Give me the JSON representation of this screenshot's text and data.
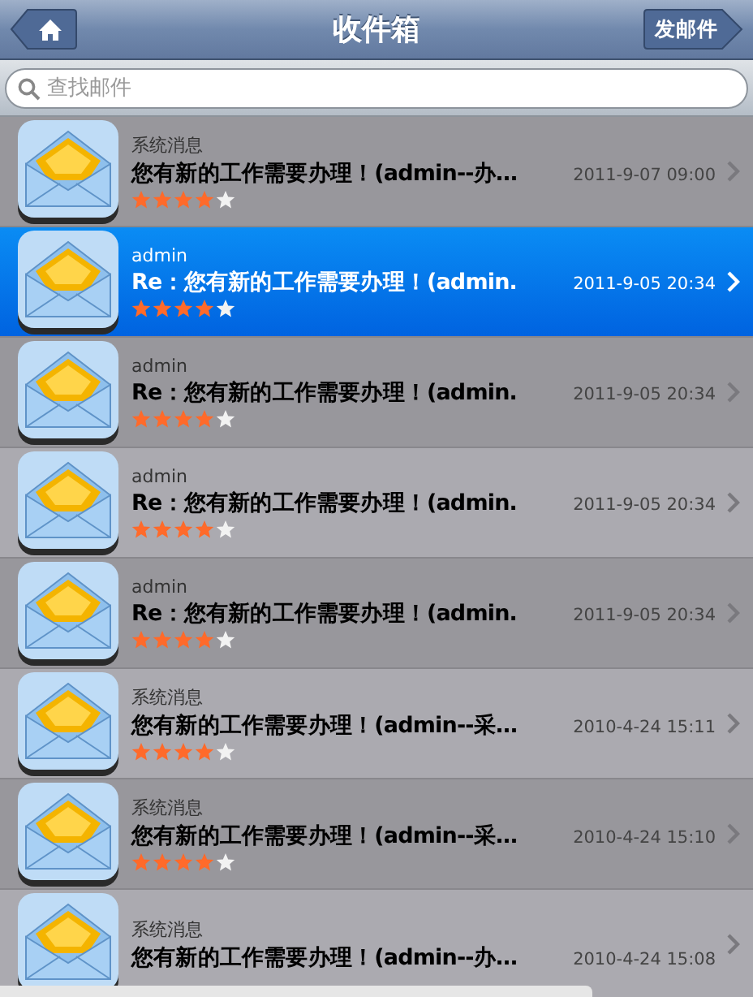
{
  "header": {
    "title": "收件箱",
    "home_button": true,
    "action_button": "发邮件"
  },
  "search": {
    "placeholder": "查找邮件"
  },
  "messages": [
    {
      "sender": "系统消息",
      "subject": "您有新的工作需要办理！(admin--办…",
      "date": "2011-9-07 09:00",
      "stars": 4,
      "selected": false
    },
    {
      "sender": "admin",
      "subject": "Re：您有新的工作需要办理！(admin.",
      "date": "2011-9-05 20:34",
      "stars": 4,
      "selected": true
    },
    {
      "sender": "admin",
      "subject": "Re：您有新的工作需要办理！(admin.",
      "date": "2011-9-05 20:34",
      "stars": 4,
      "selected": false
    },
    {
      "sender": "admin",
      "subject": "Re：您有新的工作需要办理！(admin.",
      "date": "2011-9-05 20:34",
      "stars": 4,
      "selected": false
    },
    {
      "sender": "admin",
      "subject": "Re：您有新的工作需要办理！(admin.",
      "date": "2011-9-05 20:34",
      "stars": 4,
      "selected": false
    },
    {
      "sender": "系统消息",
      "subject": "您有新的工作需要办理！(admin--采…",
      "date": "2010-4-24 15:11",
      "stars": 4,
      "selected": false
    },
    {
      "sender": "系统消息",
      "subject": "您有新的工作需要办理！(admin--采…",
      "date": "2010-4-24 15:10",
      "stars": 4,
      "selected": false
    },
    {
      "sender": "系统消息",
      "subject": "您有新的工作需要办理！(admin--办…",
      "date": "2010-4-24 15:08",
      "selected": false
    }
  ]
}
